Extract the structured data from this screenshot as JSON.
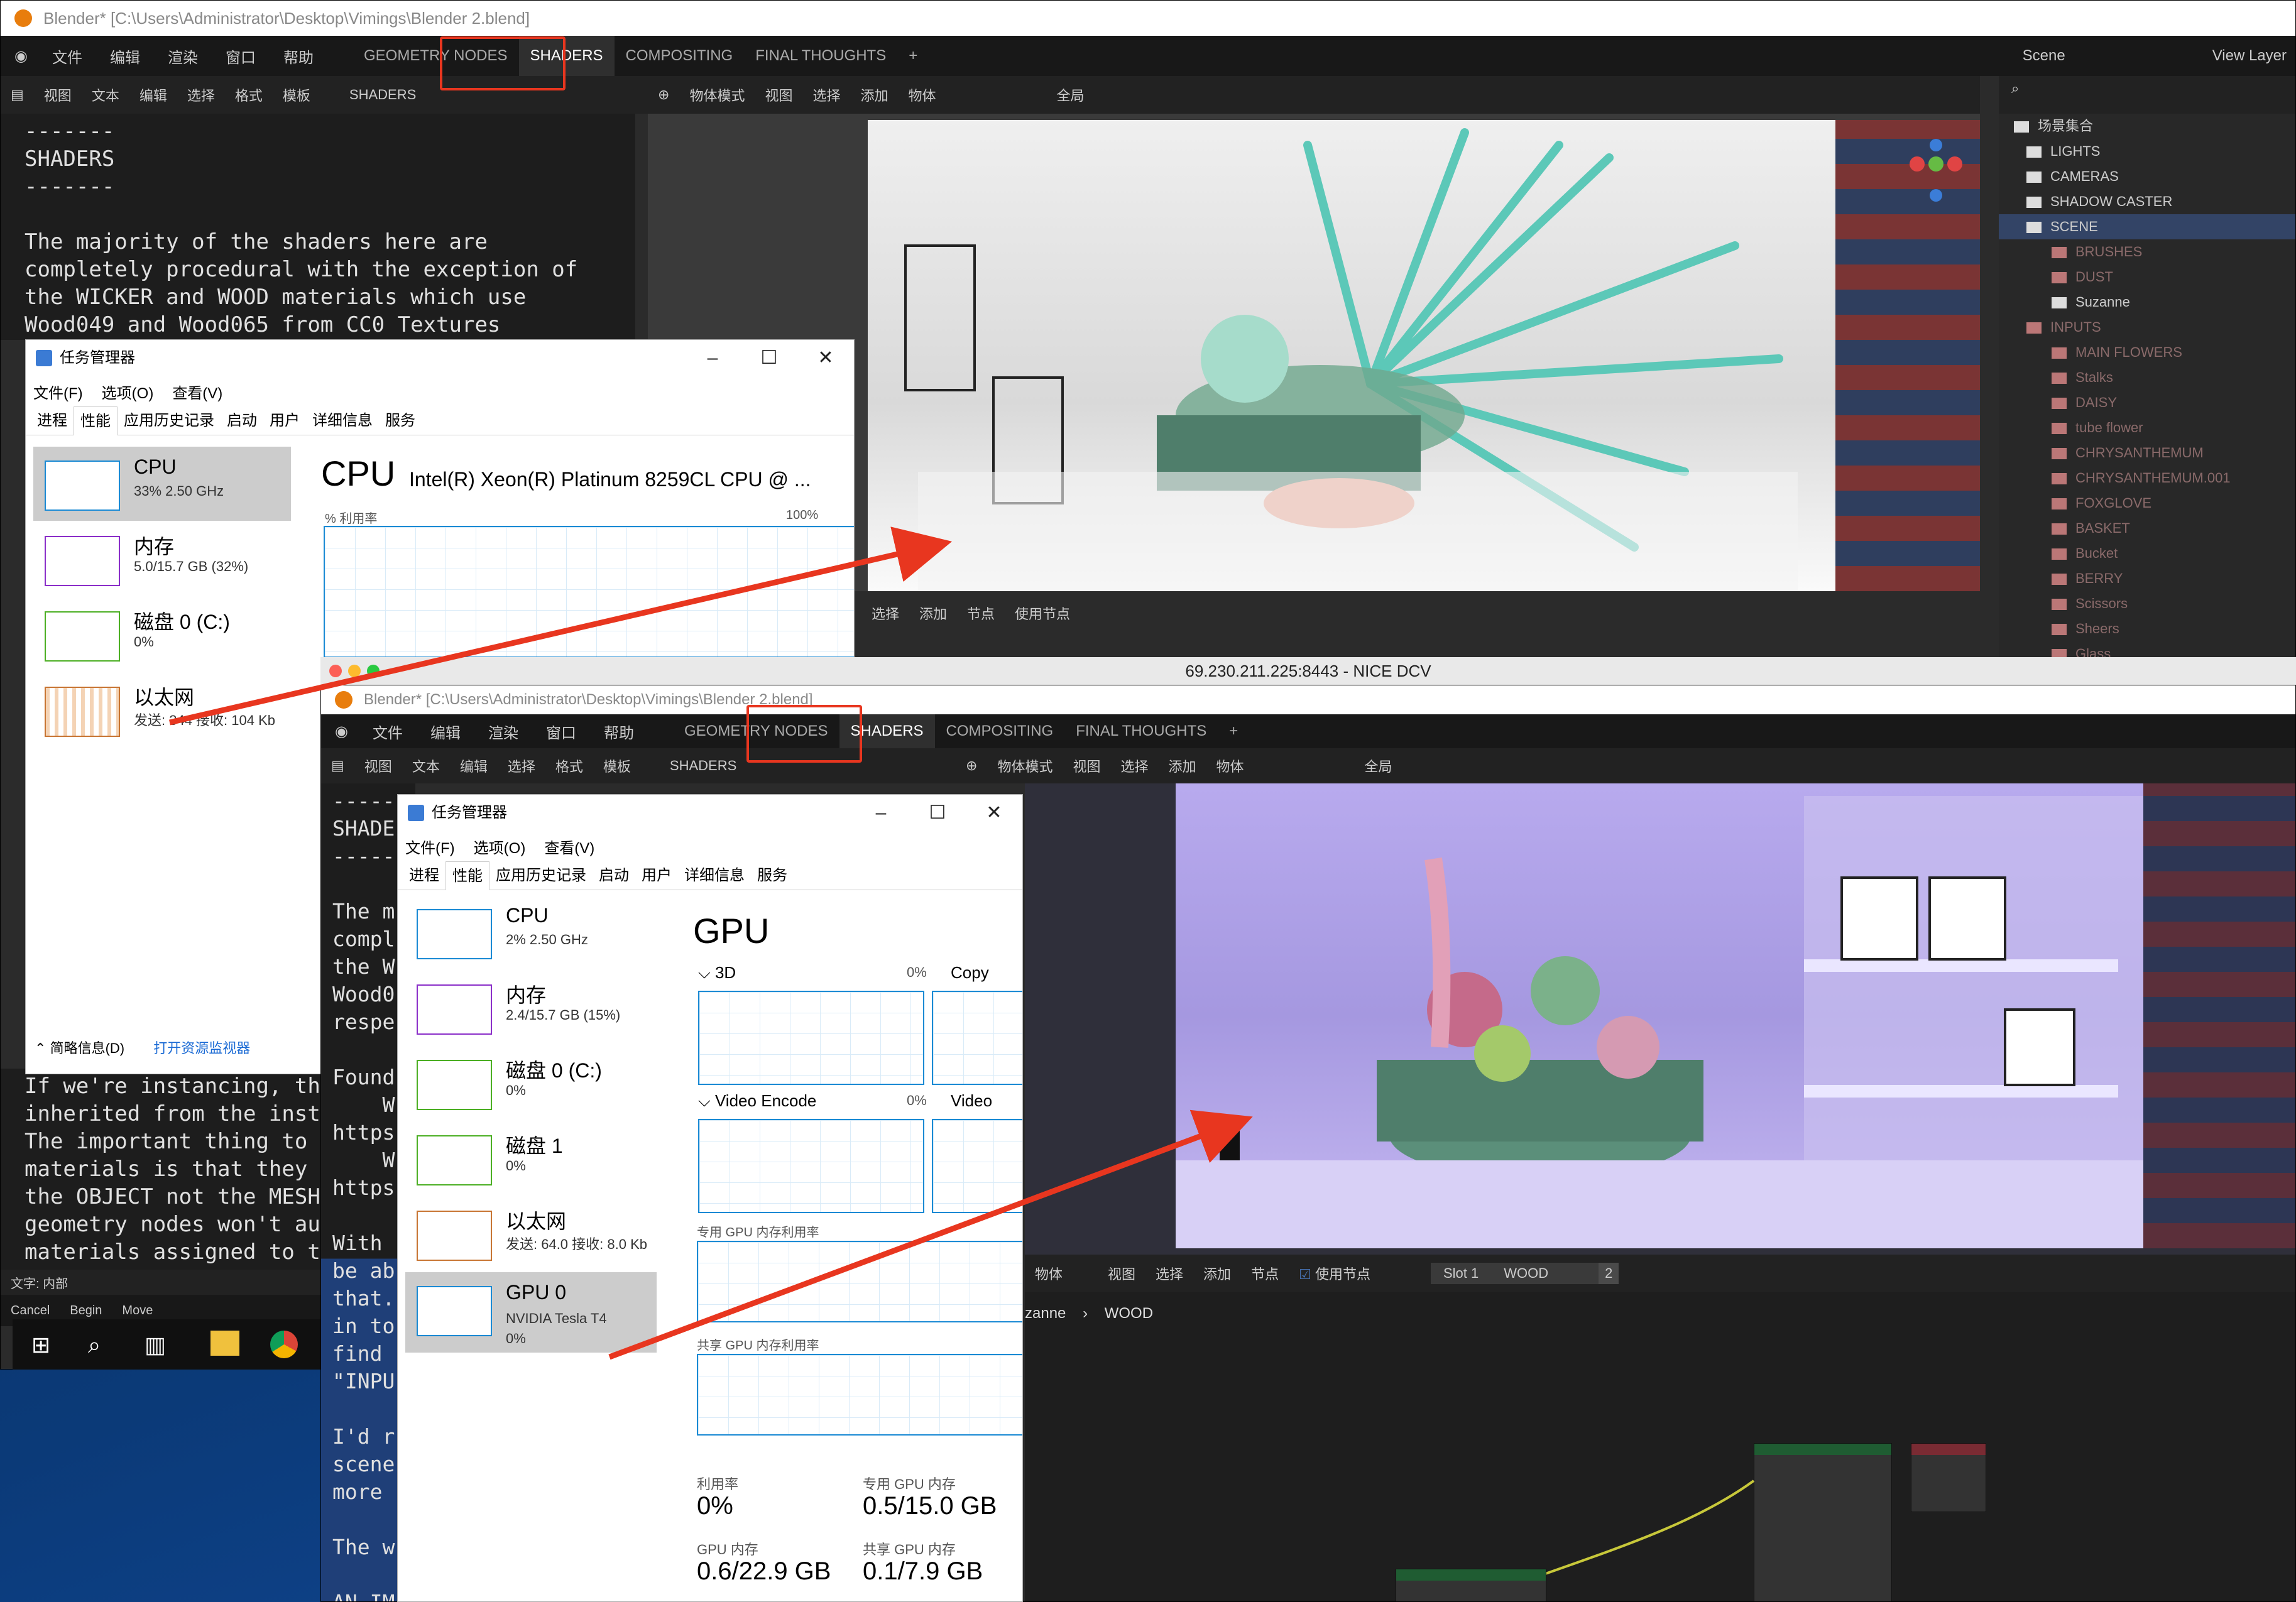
{
  "window1": {
    "title": "Blender* [C:\\Users\\Administrator\\Desktop\\Vimings\\Blender 2.blend]",
    "menu": [
      "文件",
      "编辑",
      "渲染",
      "窗口",
      "帮助"
    ],
    "workspaces": [
      "GEOMETRY NODES",
      "SHADERS",
      "COMPOSITING",
      "FINAL THOUGHTS",
      "+"
    ],
    "text_header": [
      "视图",
      "文本",
      "编辑",
      "选择",
      "格式",
      "模板"
    ],
    "text_name": "SHADERS",
    "text_lines": "-------\nSHADERS\n-------\n\nThe majority of the shaders here are\ncompletely procedural with the exception of\nthe WICKER and WOOD materials which use\nWood049 and Wood065 from CC0 Textures\nrespectively.",
    "text_lines_lower": "If we're instancing, the\ninherited from the insta\nThe important thing to r\nmaterials is that they r\nthe OBJECT not the MESH \ngeometry nodes won't aut\nmaterials assigned to th",
    "viewport_header": [
      "物体模式",
      "视图",
      "选择",
      "添加",
      "物体"
    ],
    "global_label": "全局",
    "scene_label": "Scene",
    "view_layer": "View Layer",
    "node_header": [
      "选择",
      "添加",
      "节点",
      "使用节点"
    ],
    "status_bar": "文字: 内部",
    "status_keys": [
      "Cancel",
      "Begin",
      "Move"
    ]
  },
  "outliner": {
    "root": "场景集合",
    "items": [
      {
        "label": "LIGHTS",
        "indent": 0,
        "dim": false
      },
      {
        "label": "CAMERAS",
        "indent": 0,
        "dim": false
      },
      {
        "label": "SHADOW CASTER",
        "indent": 0,
        "dim": false
      },
      {
        "label": "SCENE",
        "indent": 0,
        "dim": false,
        "sel": true
      },
      {
        "label": "BRUSHES",
        "indent": 1,
        "dim": true
      },
      {
        "label": "DUST",
        "indent": 1,
        "dim": true
      },
      {
        "label": "Suzanne",
        "indent": 1,
        "dim": false
      },
      {
        "label": "INPUTS",
        "indent": 0,
        "dim": true
      },
      {
        "label": "MAIN FLOWERS",
        "indent": 1,
        "dim": true
      },
      {
        "label": "Stalks",
        "indent": 1,
        "dim": true
      },
      {
        "label": "DAISY",
        "indent": 1,
        "dim": true
      },
      {
        "label": "tube flower",
        "indent": 1,
        "dim": true
      },
      {
        "label": "CHRYSANTHEMUM",
        "indent": 1,
        "dim": true
      },
      {
        "label": "CHRYSANTHEMUM.001",
        "indent": 1,
        "dim": true
      },
      {
        "label": "FOXGLOVE",
        "indent": 1,
        "dim": true
      },
      {
        "label": "BASKET",
        "indent": 1,
        "dim": true
      },
      {
        "label": "Bucket",
        "indent": 1,
        "dim": true
      },
      {
        "label": "BERRY",
        "indent": 1,
        "dim": true
      },
      {
        "label": "Scissors",
        "indent": 1,
        "dim": true
      },
      {
        "label": "Sheers",
        "indent": 1,
        "dim": true
      },
      {
        "label": "Glass",
        "indent": 1,
        "dim": true
      }
    ]
  },
  "taskmgr1": {
    "title": "任务管理器",
    "menu": [
      "文件(F)",
      "选项(O)",
      "查看(V)"
    ],
    "tabs": [
      "进程",
      "性能",
      "应用历史记录",
      "启动",
      "用户",
      "详细信息",
      "服务"
    ],
    "side": [
      {
        "name": "CPU",
        "sub": "33% 2.50 GHz"
      },
      {
        "name": "内存",
        "sub": "5.0/15.7 GB (32%)"
      },
      {
        "name": "磁盘 0 (C:)",
        "sub": "0%"
      },
      {
        "name": "以太网",
        "sub": "发送: 344 接收: 104 Kb"
      }
    ],
    "heading": "CPU",
    "cpu_model": "Intel(R) Xeon(R) Platinum 8259CL CPU @ ...",
    "util_label": "% 利用率",
    "util_max": "100%",
    "footer_less": "简略信息(D)",
    "footer_monitor": "打开资源监视器"
  },
  "dcv_title": "69.230.211.225:8443 - NICE DCV",
  "window2": {
    "title": "Blender* [C:\\Users\\Administrator\\Desktop\\Vimings\\Blender 2.blend]",
    "text_lines": "-----\nSHADE\n-----\n\nThe m\ncompl\nthe W\nWood0\nrespe\n\nFound\n    W\nhttps\n    W\nhttps\n\nWith \nbe ab\nthat.\nin to\nfind \n\"INPU\n\nI'd r\nscene\nmore \n\nThe w\n\nAN IM",
    "node_header": [
      "物体",
      "视图",
      "选择",
      "添加",
      "节点",
      "使用节点"
    ],
    "slot": "Slot 1",
    "material": "WOOD",
    "users": "2",
    "breadcrumb": [
      "zanne",
      "WOOD"
    ]
  },
  "taskmgr2": {
    "title": "任务管理器",
    "menu": [
      "文件(F)",
      "选项(O)",
      "查看(V)"
    ],
    "tabs": [
      "进程",
      "性能",
      "应用历史记录",
      "启动",
      "用户",
      "详细信息",
      "服务"
    ],
    "side": [
      {
        "name": "CPU",
        "sub": "2% 2.50 GHz"
      },
      {
        "name": "内存",
        "sub": "2.4/15.7 GB (15%)"
      },
      {
        "name": "磁盘 0 (C:)",
        "sub": "0%"
      },
      {
        "name": "磁盘 1",
        "sub": "0%"
      },
      {
        "name": "以太网",
        "sub": "发送: 64.0 接收: 8.0 Kb"
      },
      {
        "name": "GPU 0",
        "sub": "NVIDIA Tesla T4\n0%"
      }
    ],
    "heading": "GPU",
    "engines": [
      {
        "name": "3D",
        "pct": "0%",
        "right": "Copy"
      },
      {
        "name": "Video Encode",
        "pct": "0%",
        "right": "Video"
      }
    ],
    "dedicated_label": "专用 GPU 内存利用率",
    "shared_label": "共享 GPU 内存利用率",
    "stats": [
      {
        "label": "利用率",
        "value": "0%"
      },
      {
        "label": "专用 GPU 内存",
        "value": "0.5/15.0 GB"
      },
      {
        "label": "GPU 内存",
        "value": "0.6/22.9 GB"
      },
      {
        "label": "共享 GPU 内存",
        "value": "0.1/7.9 GB"
      }
    ]
  },
  "colors": {
    "annotation": "#e8361f",
    "blender_accent": "#4772b3",
    "tm_blue": "#1a8ad4"
  }
}
